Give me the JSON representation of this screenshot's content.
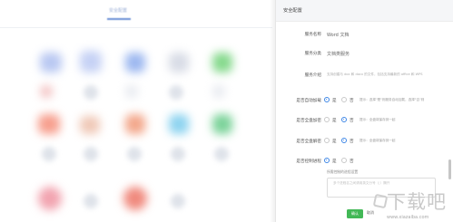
{
  "background": {
    "tab_label": "安全配置"
  },
  "dialog": {
    "title": "安全配置",
    "fields": {
      "service_name": {
        "label": "服务名称",
        "value": "Word 文档"
      },
      "service_category": {
        "label": "服务分类",
        "value": "文档类服务"
      },
      "service_intro": {
        "label": "服务介绍",
        "value": "支持创建与 doc 和 docx 的文件，包括支持最新的 office 和 WPS"
      },
      "auto_add": {
        "label": "是否自动加载",
        "options": [
          {
            "label": "是",
            "selected": true
          },
          {
            "label": "否",
            "selected": false
          }
        ],
        "hint": "提示：选择\"是\"则服务自动加载，选择\"否\"则"
      },
      "security_add": {
        "label": "是否全盘加密",
        "options": [
          {
            "label": "是",
            "selected": false
          },
          {
            "label": "否",
            "selected": true
          }
        ],
        "hint": "提示：全盘将保存到一起"
      },
      "security_decrypt": {
        "label": "是否全盘解密",
        "options": [
          {
            "label": "是",
            "selected": false
          },
          {
            "label": "否",
            "selected": true
          }
        ],
        "hint": "提示：全盘将保存到一起"
      },
      "control_process": {
        "label": "是否控制进程",
        "options": [
          {
            "label": "是",
            "selected": true
          },
          {
            "label": "否",
            "selected": false
          }
        ],
        "sub_label": "所需控制的进程设置",
        "placeholder": "多个进程名之间请用英文分号（;）隔开"
      }
    },
    "buttons": {
      "confirm": "确认",
      "cancel": "取消"
    }
  },
  "watermark": {
    "name": "下载吧",
    "url": "www.xiazaiba.com"
  },
  "colors": {
    "accent_blue": "#3d86e6",
    "confirm_green": "#42b856"
  }
}
